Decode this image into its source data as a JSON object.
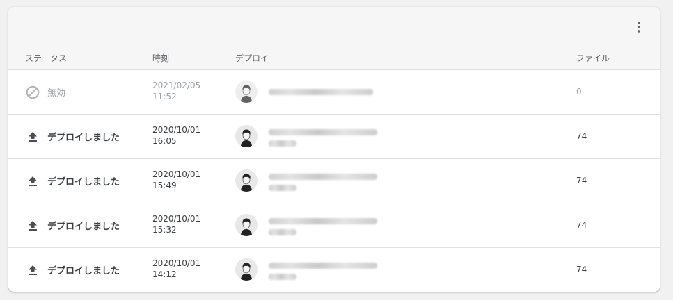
{
  "table": {
    "menu_icon": "more-vert-icon",
    "headers": {
      "status": "ステータス",
      "time": "時刻",
      "deploy": "デプロイ",
      "files": "ファイル"
    },
    "rows": [
      {
        "status_icon": "block-icon",
        "status": "無効",
        "date": "2021/02/05",
        "time": "11:52",
        "files": "0",
        "disabled": true
      },
      {
        "status_icon": "upload-icon",
        "status": "デプロイしました",
        "date": "2020/10/01",
        "time": "16:05",
        "files": "74",
        "disabled": false
      },
      {
        "status_icon": "upload-icon",
        "status": "デプロイしました",
        "date": "2020/10/01",
        "time": "15:49",
        "files": "74",
        "disabled": false
      },
      {
        "status_icon": "upload-icon",
        "status": "デプロイしました",
        "date": "2020/10/01",
        "time": "15:32",
        "files": "74",
        "disabled": false
      },
      {
        "status_icon": "upload-icon",
        "status": "デプロイしました",
        "date": "2020/10/01",
        "time": "14:12",
        "files": "74",
        "disabled": false
      }
    ]
  }
}
